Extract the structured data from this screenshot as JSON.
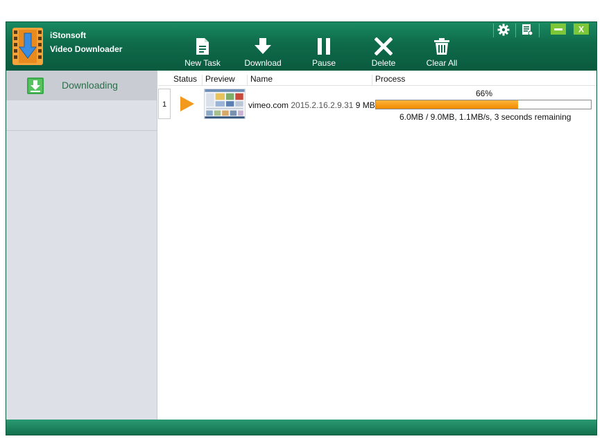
{
  "app": {
    "name_line1": "iStonsoft",
    "name_line2": "Video Downloader"
  },
  "toolbar": {
    "new_task": "New Task",
    "download": "Download",
    "pause": "Pause",
    "delete": "Delete",
    "clear_all": "Clear All"
  },
  "window_controls": {
    "settings": "gear-icon",
    "register": "register-icon",
    "minimize": "minimize-icon",
    "close": "X"
  },
  "sidebar": {
    "items": [
      {
        "label": "Downloading",
        "icon": "download-icon"
      }
    ]
  },
  "table": {
    "columns": [
      "Status",
      "Preview",
      "Name",
      "Process"
    ],
    "rows": [
      {
        "index": "1",
        "status": "play-icon",
        "name": "vimeo.com",
        "name_suffix": "2015.2.16.2.9.31",
        "size": "9 MB",
        "percent_label": "66%",
        "percent": 66,
        "progress_info": "6.0MB / 9.0MB, 1.1MB/s, 3 seconds remaining"
      }
    ]
  },
  "colors": {
    "header": "#0e6a4a",
    "accent_text": "#2a6e4a",
    "progress": "#f08a00",
    "play": "#f39a1e"
  }
}
